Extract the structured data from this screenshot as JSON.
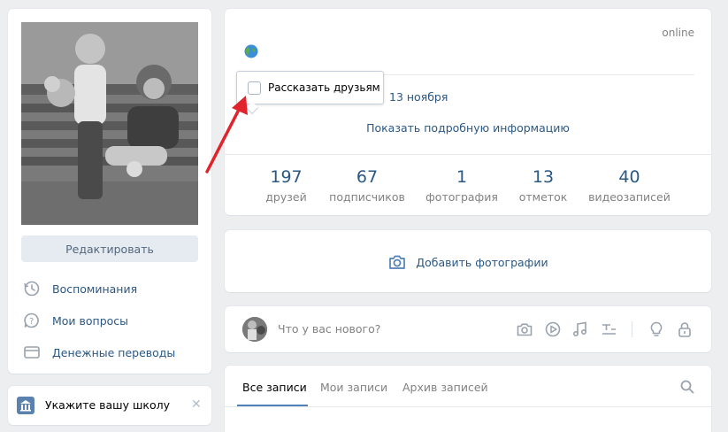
{
  "left": {
    "edit_label": "Редактировать",
    "menu": [
      {
        "label": "Воспоминания",
        "icon": "history-icon"
      },
      {
        "label": "Мои вопросы",
        "icon": "question-icon"
      },
      {
        "label": "Денежные переводы",
        "icon": "wallet-icon"
      }
    ],
    "school_prompt": "Укажите вашу школу",
    "school_close": "✕"
  },
  "profile": {
    "status": "online",
    "date": "13 ноября",
    "more_info": "Показать подробную информацию",
    "counters": [
      {
        "value": "197",
        "label": "друзей"
      },
      {
        "value": "67",
        "label": "подписчиков"
      },
      {
        "value": "1",
        "label": "фотография"
      },
      {
        "value": "13",
        "label": "отметок"
      },
      {
        "value": "40",
        "label": "видеозаписей"
      }
    ]
  },
  "popup": {
    "share_label": "Рассказать друзьям",
    "checked": false
  },
  "photos": {
    "add_label": "Добавить фотографии"
  },
  "composer": {
    "placeholder": "Что у вас нового?"
  },
  "feed": {
    "tabs": [
      "Все записи",
      "Мои записи",
      "Архив записей"
    ]
  },
  "colors": {
    "link": "#2a5885",
    "accent": "#5181b8",
    "arrow": "#e0242b",
    "background": "#edeef0"
  }
}
